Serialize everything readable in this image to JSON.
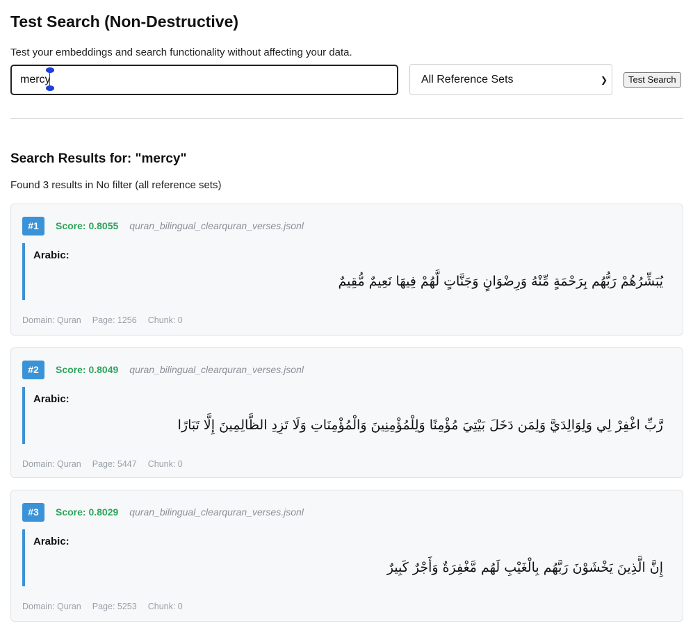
{
  "page": {
    "title": "Test Search (Non-Destructive)",
    "subtitle": "Test your embeddings and search functionality without affecting your data."
  },
  "search": {
    "value": "mercy",
    "filter_selected": "All Reference Sets",
    "button_label": "Test Search"
  },
  "results": {
    "title": "Search Results for: \"mercy\"",
    "summary": "Found 3 results in No filter (all reference sets)",
    "items": [
      {
        "rank": "#1",
        "score": "Score: 0.8055",
        "file": "quran_bilingual_clearquran_verses.jsonl",
        "label": "Arabic:",
        "text": "يُبَشِّرُهُمْ رَبُّهُم بِرَحْمَةٍ مِّنْهُ وَرِضْوَانٍ وَجَنَّاتٍ لَّهُمْ فِيهَا نَعِيمٌ مُّقِيمٌ",
        "domain": "Domain: Quran",
        "page": "Page: 1256",
        "chunk": "Chunk: 0"
      },
      {
        "rank": "#2",
        "score": "Score: 0.8049",
        "file": "quran_bilingual_clearquran_verses.jsonl",
        "label": "Arabic:",
        "text": "رَّبِّ اغْفِرْ لِي وَلِوَالِدَيَّ وَلِمَن دَخَلَ بَيْتِيَ مُؤْمِنًا وَلِلْمُؤْمِنِينَ وَالْمُؤْمِنَاتِ وَلَا تَزِدِ الظَّالِمِينَ إِلَّا تَبَارًا",
        "domain": "Domain: Quran",
        "page": "Page: 5447",
        "chunk": "Chunk: 0"
      },
      {
        "rank": "#3",
        "score": "Score: 0.8029",
        "file": "quran_bilingual_clearquran_verses.jsonl",
        "label": "Arabic:",
        "text": "إِنَّ الَّذِينَ يَخْشَوْنَ رَبَّهُم بِالْغَيْبِ لَهُم مَّغْفِرَةٌ وَأَجْرٌ كَبِيرٌ",
        "domain": "Domain: Quran",
        "page": "Page: 5253",
        "chunk": "Chunk: 0"
      }
    ]
  }
}
